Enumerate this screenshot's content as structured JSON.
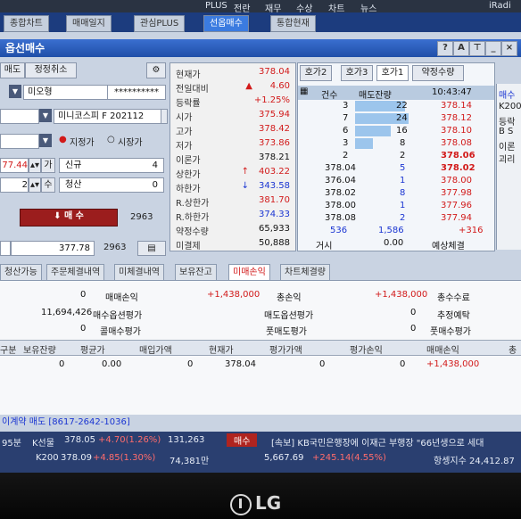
{
  "top_menu": {
    "left": "",
    "items": [
      "PLUS",
      "전란",
      "재무",
      "수상",
      "차트",
      "뉴스"
    ],
    "right": "iRadi"
  },
  "main_tabs": [
    {
      "label": "종합차트"
    },
    {
      "label": "매매일지"
    },
    {
      "label": "관심PLUS"
    },
    {
      "label": "선옵매수",
      "active": true
    },
    {
      "label": "통합현재"
    }
  ],
  "window": {
    "title": "옵선매수"
  },
  "order": {
    "tabs": [
      "매도",
      "정정취소"
    ],
    "account_name": "미오형",
    "password": "**********",
    "product": "미니코스피 F 202112",
    "order_type_limit": "지정가",
    "order_type_market": "시장가",
    "price": "77.44",
    "qty": "2",
    "new_label": "신규",
    "new_qty": "4",
    "settle_label": "청산",
    "settle_qty": "0",
    "buy_button": "매 수",
    "buy_count": "2963",
    "bottom_price": "377.78",
    "bottom_qty": "2963"
  },
  "quote": {
    "rows": [
      {
        "label": "현재가",
        "value": "378.04",
        "color": "#d21a1a"
      },
      {
        "label": "전일대비",
        "value": "4.60",
        "mark": "▲",
        "color": "#d21a1a"
      },
      {
        "label": "등락률",
        "value": "+1.25%",
        "color": "#d21a1a"
      },
      {
        "label": "시가",
        "value": "375.94",
        "color": "#d21a1a"
      },
      {
        "label": "고가",
        "value": "378.42",
        "color": "#d21a1a"
      },
      {
        "label": "저가",
        "value": "373.86",
        "color": "#d21a1a"
      },
      {
        "label": "이론가",
        "value": "378.21",
        "color": "#333333"
      },
      {
        "label": "상한가",
        "value": "403.22",
        "mark": "↑",
        "color": "#d21a1a"
      },
      {
        "label": "하한가",
        "value": "343.58",
        "mark": "↓",
        "color": "#1a35d2"
      },
      {
        "label": "R.상한가",
        "value": "381.70",
        "color": "#d21a1a"
      },
      {
        "label": "R.하한가",
        "value": "374.33",
        "color": "#1a35d2"
      },
      {
        "label": "약정수량",
        "value": "65,933",
        "color": "#333333"
      },
      {
        "label": "미결제",
        "value": "50,888",
        "color": "#333333"
      }
    ]
  },
  "orderbook": {
    "tabs": [
      "호가2",
      "호가3",
      "호가1",
      "약정수량"
    ],
    "header": {
      "count": "건수",
      "side": "매도잔량",
      "time": "10:43:47"
    },
    "asks": [
      {
        "count": "3",
        "qty": "22",
        "price": "378.14",
        "fill": 0.55
      },
      {
        "count": "7",
        "qty": "24",
        "price": "378.12",
        "fill": 0.6
      },
      {
        "count": "6",
        "qty": "16",
        "price": "378.10",
        "fill": 0.4
      },
      {
        "count": "3",
        "qty": "8",
        "price": "378.08",
        "fill": 0.2
      },
      {
        "count": "2",
        "qty": "2",
        "price": "378.06",
        "fill": 0.05
      }
    ],
    "bids": [
      {
        "price_left": "378.04",
        "count": "5",
        "price": "378.02"
      },
      {
        "price_left": "376.04",
        "count": "1",
        "price": "378.00"
      },
      {
        "price_left": "378.02",
        "count": "8",
        "price": "377.98"
      },
      {
        "price_left": "378.00",
        "count": "1",
        "price": "377.96"
      },
      {
        "price_left": "378.08",
        "count": "2",
        "price": "377.94"
      }
    ],
    "footer": {
      "left": "536",
      "mid": "1,586",
      "right": "+316"
    },
    "footer2": {
      "label": "거시",
      "value": "0.00",
      "right": "예상체결"
    },
    "side_labels": [
      "매수",
      "K200",
      "등락",
      "B S",
      "이론",
      "괴리"
    ]
  },
  "sub_tabs": [
    "청산가능",
    "주문체결내역",
    "미체결내역",
    "보유잔고",
    "미매손익",
    "차트체결량"
  ],
  "summary": {
    "rows": [
      {
        "label": "매매손익",
        "value": "0",
        "value2": "+1,438,000",
        "label2": "총손익",
        "value3": "+1,438,000",
        "label3": "총수수료"
      },
      {
        "label": "매수옵션평가",
        "value": "11,694,426",
        "label2": "매도옵션평가",
        "value3": "0",
        "label3": "추정예탁"
      },
      {
        "label": "콜매수평가",
        "value": "0",
        "label2": "풋매도평가",
        "value3": "0",
        "label3": "풋매수평가"
      }
    ]
  },
  "table": {
    "headers": [
      "구분",
      "보유잔량",
      "평균가",
      "매입가액",
      "현재가",
      "평가가액",
      "평가손익",
      "매매손익",
      "총"
    ],
    "row": [
      "",
      "0",
      "0.00",
      "0",
      "378.04",
      "0",
      "0",
      "+1,438,000",
      ""
    ]
  },
  "status": {
    "account_line": "이계약 매도 [8617-2642-1036]",
    "line1_prefix": "95분",
    "line1_label": "K선물",
    "line1_value": "378.05",
    "line1_change": "+4.70(1.26%)",
    "line1_qty": "131,263",
    "line1_tag": "매수",
    "line1_news": "[속보] KB국민은행장에 이재근 부행장 \"66년생으로 세대",
    "line2_label": "K200",
    "line2_value": "378.09",
    "line2_change": "+4.85(1.30%)",
    "line2_qty": "74,381만",
    "line2_mid": "5,667.69",
    "line2_mid_change": "+245.14(4.55%)",
    "line2_right": "항셍지수 24,412.87"
  }
}
